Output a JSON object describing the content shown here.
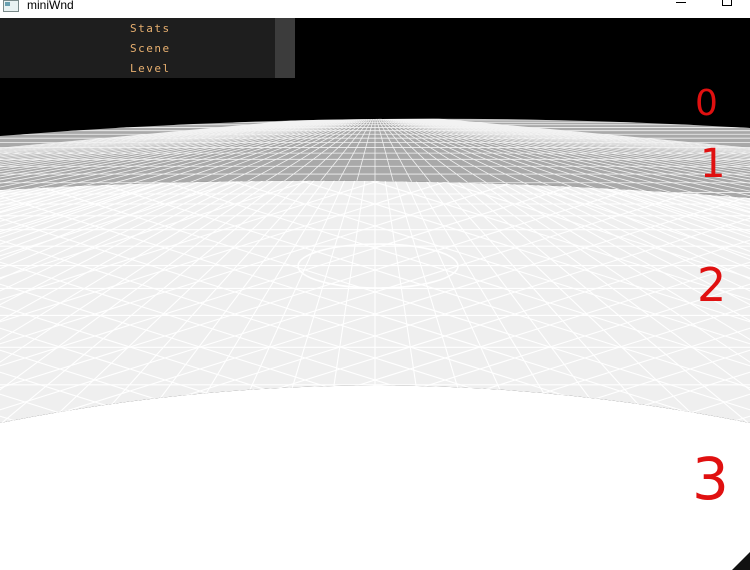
{
  "window": {
    "title": "miniWnd",
    "minimize_label": "minimize",
    "maximize_label": "maximize"
  },
  "debug_menu": {
    "items": [
      {
        "label": "Stats"
      },
      {
        "label": "Scene"
      },
      {
        "label": "Level"
      }
    ]
  },
  "annotations": [
    "0",
    "1",
    "2",
    "3"
  ],
  "colors": {
    "sky": "#000000",
    "far_ground": "#a9a9a9",
    "mid_ground": "#efefef",
    "near_ground": "#ffffff",
    "grid_line": "#ffffff",
    "menu_text": "#e8b070",
    "annotation": "#e01010"
  },
  "icons": {
    "app": "window-app-icon",
    "minimize": "minimize-icon",
    "maximize": "maximize-icon"
  }
}
